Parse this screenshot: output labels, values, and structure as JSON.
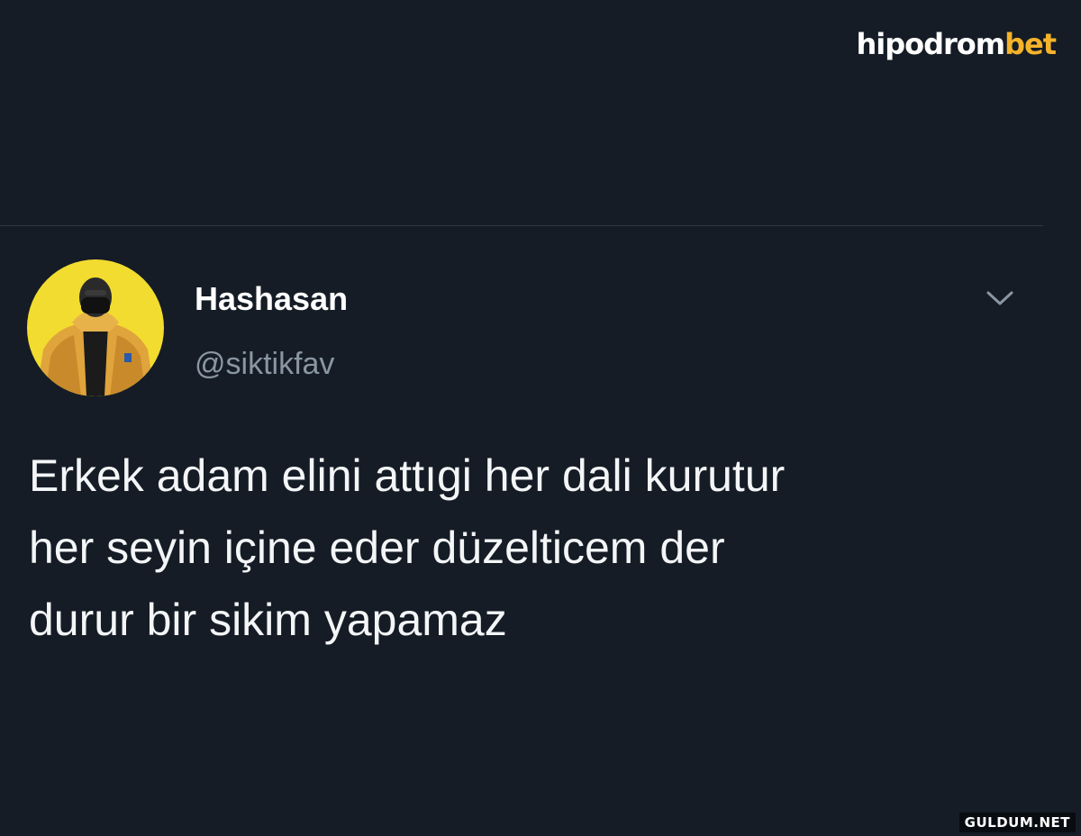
{
  "watermark_top": {
    "text_main": "hipodrom",
    "text_accent": "bet",
    "accent_color": "#f5b32a"
  },
  "tweet": {
    "display_name": "Hashasan",
    "handle": "@siktikfav",
    "text_lines": [
      "Erkek adam elini attıgi her dali kurutur",
      "her seyin içine eder düzelticem der",
      "durur bir sikim yapamaz"
    ],
    "menu_icon": "chevron-down-icon",
    "avatar_icon": "profile-avatar"
  },
  "watermark_bottom": {
    "text": "GULDUM.NET"
  },
  "colors": {
    "background": "#151c25",
    "secondary_text": "#8a96a3",
    "avatar_bg": "#f2dc2f"
  }
}
